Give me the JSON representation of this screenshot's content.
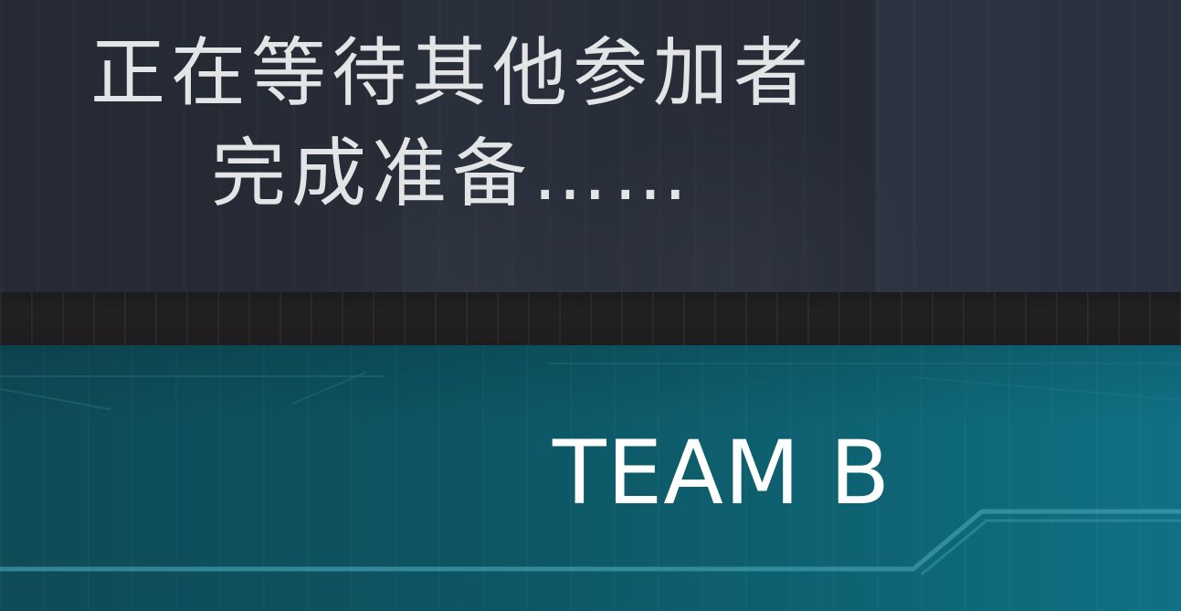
{
  "status": {
    "line1": "正在等待其他参加者",
    "line2": "完成准备……"
  },
  "team": {
    "label": "TEAM B"
  },
  "colors": {
    "panel": "#262b35",
    "banner": "#0e6474",
    "text": "#ffffff"
  }
}
